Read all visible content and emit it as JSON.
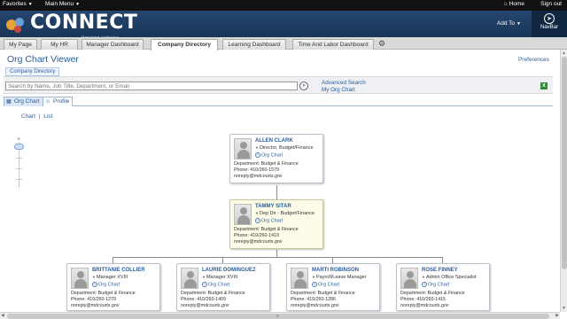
{
  "topbar": {
    "favorites_label": "Favorites",
    "main_menu_label": "Main Menu",
    "home_label": "Home",
    "signout_label": "Sign out"
  },
  "brand": {
    "logo_text": "CONNECT",
    "logo_sub": "Maryland Judiciary",
    "addto_label": "Add To",
    "navbar_label": "NavBar",
    "brand_color": "#1f3f66"
  },
  "tabs": [
    {
      "label": "My Page"
    },
    {
      "label": "My HR"
    },
    {
      "label": "Manager Dashboard"
    },
    {
      "label": "Company Directory"
    },
    {
      "label": "Learning Dashboard"
    },
    {
      "label": "Time And Labor Dashboard"
    }
  ],
  "page": {
    "title": "Org Chart Viewer",
    "preferences_label": "Preferences",
    "subtab_label": "Company Directory"
  },
  "search": {
    "placeholder": "Search by Name, Job Title, Department, or Email",
    "value": "Search by Name, Job Title, Department, or Email",
    "advanced_label": "Advanced Search",
    "myorg_label": "My Org Chart",
    "excel_glyph": "X"
  },
  "view_tabs": [
    {
      "label": "Org Chart",
      "active": true
    },
    {
      "label": "Profile",
      "active": false
    }
  ],
  "chart_switch": {
    "chart_label": "Chart",
    "separator": "|",
    "list_label": "List"
  },
  "org_link_label": "Org Chart",
  "people": [
    {
      "name": "ALLEN CLARK",
      "title": "Director, Budget/Finance",
      "department": "Department: Budget & Finance",
      "phone": "Phone: 410/260-1579",
      "email": "noreply@mdcourts.gov"
    },
    {
      "name": "TAMMY SITAR",
      "title": "Dep Dir - Budget/Finance",
      "department": "Department: Budget & Finance",
      "phone": "Phone: 410/260-1419",
      "email": "noreply@mdcourts.gov"
    },
    {
      "name": "BRITTANIE COLLIER",
      "title": "Manager XVIII",
      "department": "Department: Budget & Finance",
      "phone": "Phone: 410/260-1279",
      "email": "noreply@mdcourts.gov"
    },
    {
      "name": "LAURIE DOMINGUEZ",
      "title": "Manager XVIII",
      "department": "Department: Budget & Finance",
      "phone": "Phone: 410/260-1409",
      "email": "noreply@mdcourts.gov"
    },
    {
      "name": "MARTI ROBINSON",
      "title": "Payroll/Leave Manager",
      "department": "Department: Budget & Finance",
      "phone": "Phone: 410/260-1286",
      "email": "noreply@mdcourts.gov"
    },
    {
      "name": "ROSE FINNEY",
      "title": "Admin Office Specialist",
      "department": "Department: Budget & Finance",
      "phone": "Phone: 410/260-1415",
      "email": "noreply@mdcourts.gov"
    }
  ]
}
